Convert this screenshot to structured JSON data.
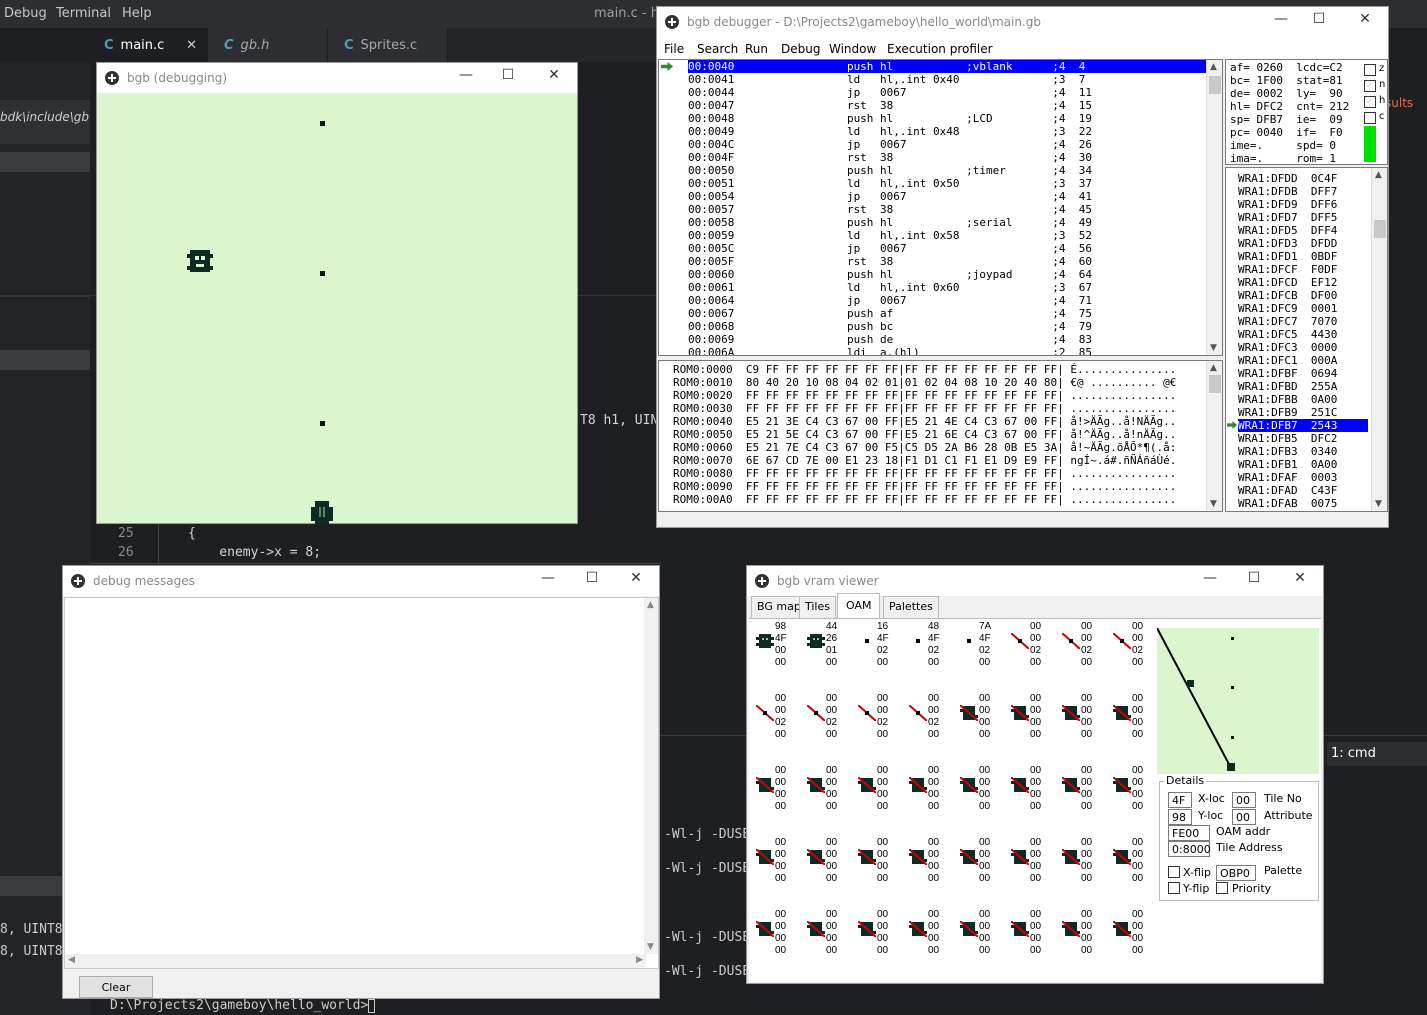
{
  "editor": {
    "menu": [
      "Debug",
      "Terminal",
      "Help"
    ],
    "window_title": "main.c - hel",
    "tabs": [
      {
        "label": "main.c",
        "icon": "C",
        "close": "✕"
      },
      {
        "label": "gb.h",
        "icon": "C"
      },
      {
        "label": "Sprites.c",
        "icon": "C"
      }
    ],
    "sidebar_path": "bdk\\include\\gb",
    "code_fragment": "T8 h1, UINT",
    "results_fragment": "sults",
    "line_numbers": [
      "25",
      "26"
    ],
    "code_lines": [
      "{",
      "    enemy->x = 8;"
    ],
    "terminal_lines": [
      "-Wl-j -DUSE_",
      "-Wl-j -DUSE_",
      "-Wl-j -DUSE_",
      "-Wl-j -DUSE_"
    ],
    "left_fragments": [
      "8, UINT8, U",
      "8, UINT8, U"
    ],
    "terminal_tab": "1: cmd",
    "prompt": "D:\\Projects2\\gameboy\\hello_world>"
  },
  "bgb_window": {
    "title": "bgb (debugging)",
    "screen_color": "#dbf5cf"
  },
  "debugger": {
    "title": "bgb debugger - D:\\Projects2\\gameboy\\hello_world\\main.gb",
    "menu": [
      "File",
      "Search",
      "Run",
      "Debug",
      "Window",
      "Execution profiler"
    ],
    "disasm": [
      "00:0040                 push hl           ;vblank      ;4  4",
      "00:0041                 ld   hl,.int 0x40              ;3  7",
      "00:0044                 jp   0067                      ;4  11",
      "00:0047                 rst  38                        ;4  15",
      "00:0048                 push hl           ;LCD         ;4  19",
      "00:0049                 ld   hl,.int 0x48              ;3  22",
      "00:004C                 jp   0067                      ;4  26",
      "00:004F                 rst  38                        ;4  30",
      "00:0050                 push hl           ;timer       ;4  34",
      "00:0051                 ld   hl,.int 0x50              ;3  37",
      "00:0054                 jp   0067                      ;4  41",
      "00:0057                 rst  38                        ;4  45",
      "00:0058                 push hl           ;serial      ;4  49",
      "00:0059                 ld   hl,.int 0x58              ;3  52",
      "00:005C                 jp   0067                      ;4  56",
      "00:005F                 rst  38                        ;4  60",
      "00:0060                 push hl           ;joypad      ;4  64",
      "00:0061                 ld   hl,.int 0x60              ;3  67",
      "00:0064                 jp   0067                      ;4  71",
      "00:0067                 push af                        ;4  75",
      "00:0068                 push bc                        ;4  79",
      "00:0069                 push de                        ;4  83",
      "00:006A                 ldi  a,(hl)                    ;2  85"
    ],
    "hexdump": [
      "ROM0:0000  C9 FF FF FF FF FF FF FF|FF FF FF FF FF FF FF FF| É...............",
      "ROM0:0010  80 40 20 10 08 04 02 01|01 02 04 08 10 20 40 80| €@ .......... @€",
      "ROM0:0020  FF FF FF FF FF FF FF FF|FF FF FF FF FF FF FF FF| ................",
      "ROM0:0030  FF FF FF FF FF FF FF FF|FF FF FF FF FF FF FF FF| ................",
      "ROM0:0040  E5 21 3E C4 C3 67 00 FF|E5 21 4E C4 C3 67 00 FF| å!>ÄÃg..å!NÄÃg..",
      "ROM0:0050  E5 21 5E C4 C3 67 00 FF|E5 21 6E C4 C3 67 00 FF| å!^ÄÃg..å!nÄÃg..",
      "ROM0:0060  E5 21 7E C4 C3 67 00 F5|C5 D5 2A B6 28 0B E5 3A| å!~ÄÃg.õÅÕ*¶(.å:",
      "ROM0:0070  6E 67 CD 7E 00 E1 23 18|F1 D1 C1 F1 E1 D9 E9 FF| ngÍ~.á#.ñÑÁñáÙé.",
      "ROM0:0080  FF FF FF FF FF FF FF FF|FF FF FF FF FF FF FF FF| ................",
      "ROM0:0090  FF FF FF FF FF FF FF FF|FF FF FF FF FF FF FF FF| ................",
      "ROM0:00A0  FF FF FF FF FF FF FF FF|FF FF FF FF FF FF FF FF| ................"
    ],
    "registers": [
      "af= 0260  lcdc=C2",
      "bc= 1F00  stat=81",
      "de= 0002  ly=  90",
      "hl= DFC2  cnt= 212",
      "sp= DFB7  ie=  09",
      "pc= 0040  if=  F0",
      "ime=.     spd= 0",
      "ima=.     rom= 1"
    ],
    "flags": [
      "z",
      "n",
      "h",
      "c"
    ],
    "flags_checked": [
      false,
      true,
      true,
      false
    ],
    "stack": [
      "WRA1:DFDD  0C4F",
      "WRA1:DFDB  DFF7",
      "WRA1:DFD9  DFF6",
      "WRA1:DFD7  DFF5",
      "WRA1:DFD5  DFF4",
      "WRA1:DFD3  DFDD",
      "WRA1:DFD1  0BDF",
      "WRA1:DFCF  F0DF",
      "WRA1:DFCD  EF12",
      "WRA1:DFCB  DF00",
      "WRA1:DFC9  0001",
      "WRA1:DFC7  7070",
      "WRA1:DFC5  4430",
      "WRA1:DFC3  0000",
      "WRA1:DFC1  000A",
      "WRA1:DFBF  0694",
      "WRA1:DFBD  255A",
      "WRA1:DFBB  0A00",
      "WRA1:DFB9  251C",
      "WRA1:DFB7  2543",
      "WRA1:DFB5  DFC2",
      "WRA1:DFB3  0340",
      "WRA1:DFB1  0A00",
      "WRA1:DFAF  0003",
      "WRA1:DFAD  C43F",
      "WRA1:DFAB  0075"
    ]
  },
  "debug_messages": {
    "title": "debug messages",
    "clear_label": "Clear"
  },
  "vram": {
    "title": "bgb vram viewer",
    "tabs": [
      "BG map",
      "Tiles",
      "OAM",
      "Palettes"
    ],
    "active_tab": "OAM",
    "oam": [
      [
        "98",
        "4F",
        "00",
        "00"
      ],
      [
        "44",
        "26",
        "01",
        "00"
      ],
      [
        "16",
        "4F",
        "02",
        "00"
      ],
      [
        "48",
        "4F",
        "02",
        "00"
      ],
      [
        "7A",
        "4F",
        "02",
        "00"
      ],
      [
        "00",
        "00",
        "02",
        "00"
      ],
      [
        "00",
        "00",
        "02",
        "00"
      ],
      [
        "00",
        "00",
        "02",
        "00"
      ],
      [
        "00",
        "00",
        "02",
        "00"
      ],
      [
        "00",
        "00",
        "02",
        "00"
      ],
      [
        "00",
        "00",
        "02",
        "00"
      ],
      [
        "00",
        "00",
        "02",
        "00"
      ],
      [
        "00",
        "00",
        "00",
        "00"
      ],
      [
        "00",
        "00",
        "00",
        "00"
      ],
      [
        "00",
        "00",
        "00",
        "00"
      ],
      [
        "00",
        "00",
        "00",
        "00"
      ],
      [
        "00",
        "00",
        "00",
        "00"
      ],
      [
        "00",
        "00",
        "00",
        "00"
      ],
      [
        "00",
        "00",
        "00",
        "00"
      ],
      [
        "00",
        "00",
        "00",
        "00"
      ],
      [
        "00",
        "00",
        "00",
        "00"
      ],
      [
        "00",
        "00",
        "00",
        "00"
      ],
      [
        "00",
        "00",
        "00",
        "00"
      ],
      [
        "00",
        "00",
        "00",
        "00"
      ],
      [
        "00",
        "00",
        "00",
        "00"
      ],
      [
        "00",
        "00",
        "00",
        "00"
      ],
      [
        "00",
        "00",
        "00",
        "00"
      ],
      [
        "00",
        "00",
        "00",
        "00"
      ],
      [
        "00",
        "00",
        "00",
        "00"
      ],
      [
        "00",
        "00",
        "00",
        "00"
      ],
      [
        "00",
        "00",
        "00",
        "00"
      ],
      [
        "00",
        "00",
        "00",
        "00"
      ],
      [
        "00",
        "00",
        "00",
        "00"
      ],
      [
        "00",
        "00",
        "00",
        "00"
      ],
      [
        "00",
        "00",
        "00",
        "00"
      ],
      [
        "00",
        "00",
        "00",
        "00"
      ],
      [
        "00",
        "00",
        "00",
        "00"
      ],
      [
        "00",
        "00",
        "00",
        "00"
      ],
      [
        "00",
        "00",
        "00",
        "00"
      ],
      [
        "00",
        "00",
        "00",
        "00"
      ]
    ],
    "oam_icons": [
      "sprite",
      "sprite",
      "dot",
      "dot",
      "dot",
      "slash",
      "slash",
      "slash",
      "slash",
      "slash",
      "slash",
      "slash",
      "crossed",
      "crossed",
      "crossed",
      "crossed",
      "crossed",
      "crossed",
      "crossed",
      "crossed",
      "crossed",
      "crossed",
      "crossed",
      "crossed",
      "crossed",
      "crossed",
      "crossed",
      "crossed",
      "crossed",
      "crossed",
      "crossed",
      "crossed",
      "crossed",
      "crossed",
      "crossed",
      "crossed",
      "crossed",
      "crossed",
      "crossed",
      "crossed"
    ],
    "details": {
      "legend": "Details",
      "x_loc": "4F",
      "x_loc_label": "X-loc",
      "y_loc": "98",
      "y_loc_label": "Y-loc",
      "tile_no": "00",
      "tile_no_label": "Tile No",
      "attribute": "00",
      "attribute_label": "Attribute",
      "oam_addr": "FE00",
      "oam_addr_label": "OAM addr",
      "tile_address": "0:8000",
      "tile_address_label": "Tile Address",
      "xflip_label": "X-flip",
      "yflip_label": "Y-flip",
      "palette": "OBP0",
      "palette_label": "Palette",
      "priority_label": "Priority"
    }
  }
}
